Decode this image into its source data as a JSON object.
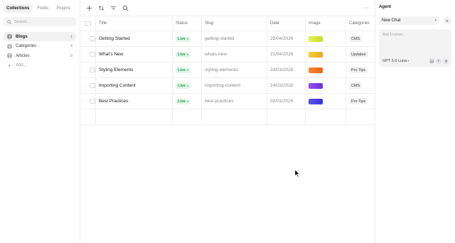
{
  "sidebar": {
    "tabs": [
      {
        "label": "Collections",
        "active": true
      },
      {
        "label": "Fields",
        "active": false
      },
      {
        "label": "Plugins",
        "active": false
      }
    ],
    "search_placeholder": "Search...",
    "items": [
      {
        "label": "Blogs",
        "count": "1",
        "active": true,
        "icon": "database-icon"
      },
      {
        "label": "Categories",
        "count": "4",
        "active": false,
        "icon": "database-icon"
      },
      {
        "label": "Articles",
        "count": "0",
        "active": false,
        "icon": "database-icon"
      }
    ],
    "add_label": "Add..."
  },
  "toolbar": {
    "icons": [
      "plus-icon",
      "sort-icon",
      "filter-icon",
      "search-icon"
    ],
    "more": "···"
  },
  "table": {
    "headers": {
      "title": "Title",
      "status": "Status",
      "slug": "Slug",
      "date": "Date",
      "image": "Image",
      "category": "Categories"
    },
    "rows": [
      {
        "title": "Getting Started",
        "status": "Live",
        "slug": "getting-started",
        "date": "28/04/2026",
        "image_color": "#d9e84a",
        "category": "CMS"
      },
      {
        "title": "What's New",
        "status": "Live",
        "slug": "whats-new",
        "date": "21/04/2026",
        "image_color": "#f2c230",
        "category": "Updates"
      },
      {
        "title": "Styling Elements",
        "status": "Live",
        "slug": "styling-elements",
        "date": "24/03/2026",
        "image_color": "#f27a2a",
        "category": "Pro Tips"
      },
      {
        "title": "Importing Content",
        "status": "Live",
        "slug": "importing-content",
        "date": "14/03/2026",
        "image_color": "#8a3ff0",
        "category": "CMS"
      },
      {
        "title": "Best Practices",
        "status": "Live",
        "slug": "best-practices",
        "date": "02/03/2026",
        "image_color": "#4a44e6",
        "category": "Pro Tips"
      }
    ]
  },
  "agent": {
    "title": "Agent",
    "chat_select": "New Chat",
    "composer_placeholder": "Ask Framer...",
    "model": "GPT 5.6 Luna"
  },
  "colors": {
    "live_bg": "#e3f6ea",
    "live_text": "#1f9d55",
    "border": "#efefef"
  }
}
